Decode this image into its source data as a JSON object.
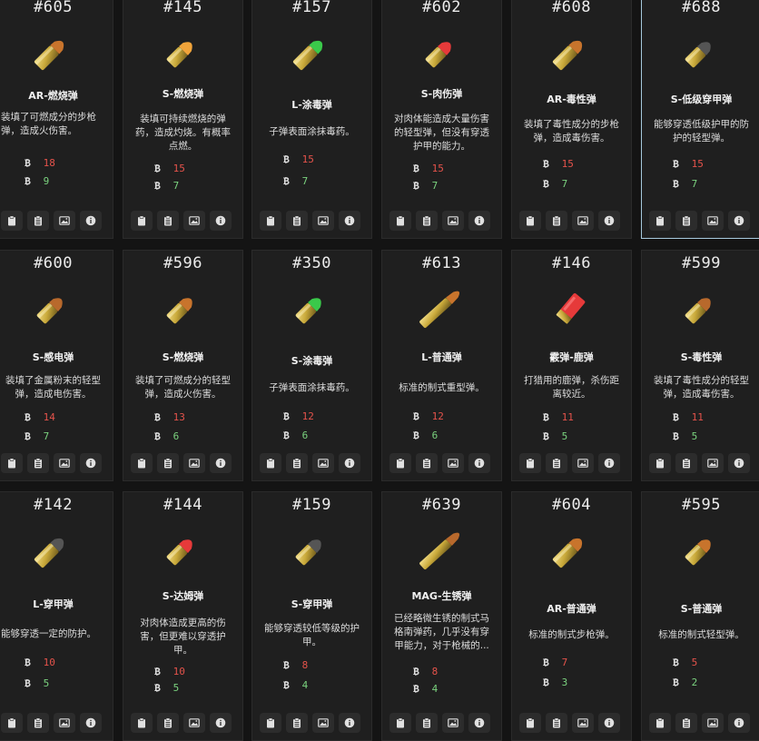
{
  "currency_glyph": "₿",
  "colors": {
    "damage": "#e5534b",
    "penetration": "#7bd37f",
    "selected_border": "#a7c9dd"
  },
  "action_icons": [
    "clipboard-icon",
    "clipboard-list-icon",
    "image-icon",
    "info-icon"
  ],
  "cards": [
    {
      "id": "#605",
      "name": "AR-燃烧弹",
      "desc": "装填了可燃成分的步枪弹，造成火伤害。",
      "damage": "18",
      "penetration": "9",
      "bullet": {
        "type": "rifle",
        "tip": "#c8742c"
      }
    },
    {
      "id": "#145",
      "name": "S-燃烧弹",
      "desc": "装填可持续燃烧的弹药，造成灼烧。有概率点燃。",
      "damage": "15",
      "penetration": "7",
      "bullet": {
        "type": "pistol",
        "tip": "#f1a43a"
      }
    },
    {
      "id": "#157",
      "name": "L-涂毒弹",
      "desc": "子弹表面涂抹毒药。",
      "damage": "15",
      "penetration": "7",
      "bullet": {
        "type": "rifle",
        "tip": "#3ac94a"
      }
    },
    {
      "id": "#602",
      "name": "S-肉伤弹",
      "desc": "对肉体能造成大量伤害的轻型弹，但没有穿透护甲的能力。",
      "damage": "15",
      "penetration": "7",
      "bullet": {
        "type": "pistol",
        "tip": "#e63a3a"
      }
    },
    {
      "id": "#608",
      "name": "AR-毒性弹",
      "desc": "装填了毒性成分的步枪弹，造成毒伤害。",
      "damage": "15",
      "penetration": "7",
      "bullet": {
        "type": "rifle",
        "tip": "#c8742c"
      }
    },
    {
      "id": "#688",
      "name": "S-低级穿甲弹",
      "desc": "能够穿透低级护甲的防护的轻型弹。",
      "damage": "15",
      "penetration": "7",
      "bullet": {
        "type": "pistol",
        "tip": "#555555"
      },
      "selected": true
    },
    {
      "id": "#600",
      "name": "S-感电弹",
      "desc": "装填了金属粉末的轻型弹，造成电伤害。",
      "damage": "14",
      "penetration": "7",
      "bullet": {
        "type": "pistol",
        "tip": "#b8692c"
      }
    },
    {
      "id": "#596",
      "name": "S-燃烧弹",
      "desc": "装填了可燃成分的轻型弹，造成火伤害。",
      "damage": "13",
      "penetration": "6",
      "bullet": {
        "type": "pistol",
        "tip": "#c8742c"
      }
    },
    {
      "id": "#350",
      "name": "S-涂毒弹",
      "desc": "子弹表面涂抹毒药。",
      "damage": "12",
      "penetration": "6",
      "bullet": {
        "type": "pistol",
        "tip": "#3ac94a"
      }
    },
    {
      "id": "#613",
      "name": "L-普通弹",
      "desc": "标准的制式重型弹。",
      "damage": "12",
      "penetration": "6",
      "bullet": {
        "type": "long",
        "tip": "#c8742c"
      }
    },
    {
      "id": "#146",
      "name": "霰弹-鹿弹",
      "desc": "打猎用的鹿弹，杀伤距离较近。",
      "damage": "11",
      "penetration": "5",
      "bullet": {
        "type": "shell",
        "tip": "#e63a3a"
      }
    },
    {
      "id": "#599",
      "name": "S-毒性弹",
      "desc": "装填了毒性成分的轻型弹，造成毒伤害。",
      "damage": "11",
      "penetration": "5",
      "bullet": {
        "type": "pistol",
        "tip": "#b8692c"
      }
    },
    {
      "id": "#142",
      "name": "L-穿甲弹",
      "desc": "能够穿透一定的防护。",
      "damage": "10",
      "penetration": "5",
      "bullet": {
        "type": "rifle",
        "tip": "#555555"
      }
    },
    {
      "id": "#144",
      "name": "S-达姆弹",
      "desc": "对肉体造成更高的伤害，但更难以穿透护甲。",
      "damage": "10",
      "penetration": "5",
      "bullet": {
        "type": "pistol",
        "tip": "#e63a3a"
      }
    },
    {
      "id": "#159",
      "name": "S-穿甲弹",
      "desc": "能够穿透较低等级的护甲。",
      "damage": "8",
      "penetration": "4",
      "bullet": {
        "type": "pistol",
        "tip": "#555555"
      }
    },
    {
      "id": "#639",
      "name": "MAG-生锈弹",
      "desc": "已经略微生锈的制式马格南弹药，几乎没有穿甲能力，对于枪械的...",
      "damage": "8",
      "penetration": "4",
      "bullet": {
        "type": "long",
        "tip": "#b8692c"
      }
    },
    {
      "id": "#604",
      "name": "AR-普通弹",
      "desc": "标准的制式步枪弹。",
      "damage": "7",
      "penetration": "3",
      "bullet": {
        "type": "rifle",
        "tip": "#c8742c"
      }
    },
    {
      "id": "#595",
      "name": "S-普通弹",
      "desc": "标准的制式轻型弹。",
      "damage": "5",
      "penetration": "2",
      "bullet": {
        "type": "pistol",
        "tip": "#c8742c"
      }
    }
  ]
}
